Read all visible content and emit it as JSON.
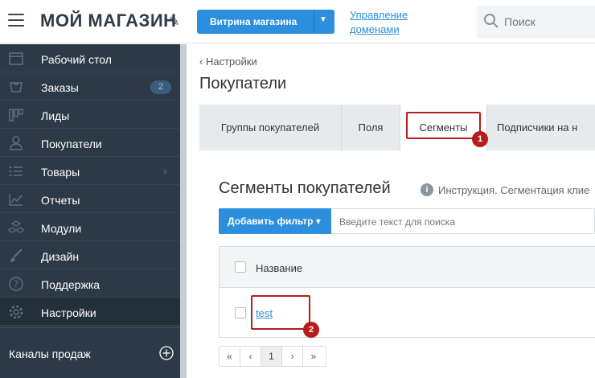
{
  "header": {
    "title": "МОЙ МАГАЗИН",
    "storefront_button": "Витрина магазина",
    "domains_link": "Управление доменами",
    "search_placeholder": "Поиск"
  },
  "sidebar": {
    "items": [
      {
        "label": "Рабочий стол",
        "icon": "browser-window-icon"
      },
      {
        "label": "Заказы",
        "icon": "cart-icon",
        "badge": "2"
      },
      {
        "label": "Лиды",
        "icon": "kanban-icon"
      },
      {
        "label": "Покупатели",
        "icon": "user-icon"
      },
      {
        "label": "Товары",
        "icon": "list-icon"
      },
      {
        "label": "Отчеты",
        "icon": "chart-icon"
      },
      {
        "label": "Модули",
        "icon": "cubes-icon"
      },
      {
        "label": "Дизайн",
        "icon": "brush-icon"
      },
      {
        "label": "Поддержка",
        "icon": "help-icon"
      },
      {
        "label": "Настройки",
        "icon": "gear-icon"
      }
    ],
    "channels_label": "Каналы продаж"
  },
  "main": {
    "breadcrumb": "Настройки",
    "page_title": "Покупатели",
    "tabs": [
      {
        "label": "Группы покупателей"
      },
      {
        "label": "Поля"
      },
      {
        "label": "Сегменты"
      },
      {
        "label": "Подписчики на н"
      }
    ],
    "section_title": "Сегменты покупателей",
    "info_text": "Инструкция. Сегментация клие",
    "filter_button": "Добавить фильтр",
    "filter_placeholder": "Введите текст для поиска",
    "table": {
      "column_name": "Название",
      "rows": [
        {
          "name": "test"
        }
      ]
    },
    "pagination": [
      "«",
      "‹",
      "1",
      "›",
      "»"
    ]
  },
  "annotations": [
    "1",
    "2"
  ],
  "colors": {
    "accent": "#2b8fde",
    "sidebar_bg": "#2c3a47",
    "highlight": "#b71c1c"
  }
}
